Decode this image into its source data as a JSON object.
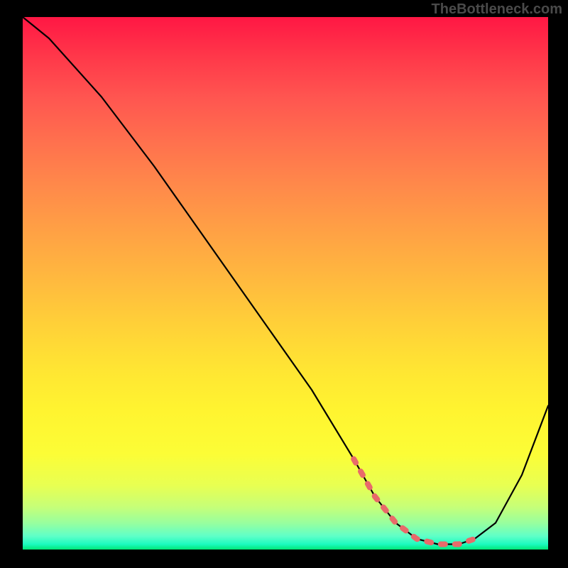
{
  "watermark": "TheBottleneck.com",
  "chart_data": {
    "type": "line",
    "title": "",
    "xlabel": "",
    "ylabel": "",
    "xlim": [
      0,
      100
    ],
    "ylim": [
      0,
      100
    ],
    "series": [
      {
        "name": "curve",
        "x": [
          0,
          5,
          15,
          25,
          35,
          45,
          55,
          63,
          67,
          71,
          75,
          79,
          83,
          86,
          90,
          95,
          100
        ],
        "values": [
          100,
          96,
          85,
          72,
          58,
          44,
          30,
          17,
          10,
          5,
          2,
          1,
          1,
          2,
          5,
          14,
          27
        ]
      }
    ],
    "highlight": {
      "name": "bottom-segment",
      "x": [
        63,
        67,
        71,
        75,
        79,
        83,
        86
      ],
      "values": [
        17,
        10,
        5,
        2,
        1,
        1,
        2
      ]
    },
    "gradient_stops": [
      {
        "pos": 0,
        "color": "#ff1744"
      },
      {
        "pos": 50,
        "color": "#ffbb3e"
      },
      {
        "pos": 82,
        "color": "#fcfd36"
      },
      {
        "pos": 100,
        "color": "#00e676"
      }
    ]
  }
}
